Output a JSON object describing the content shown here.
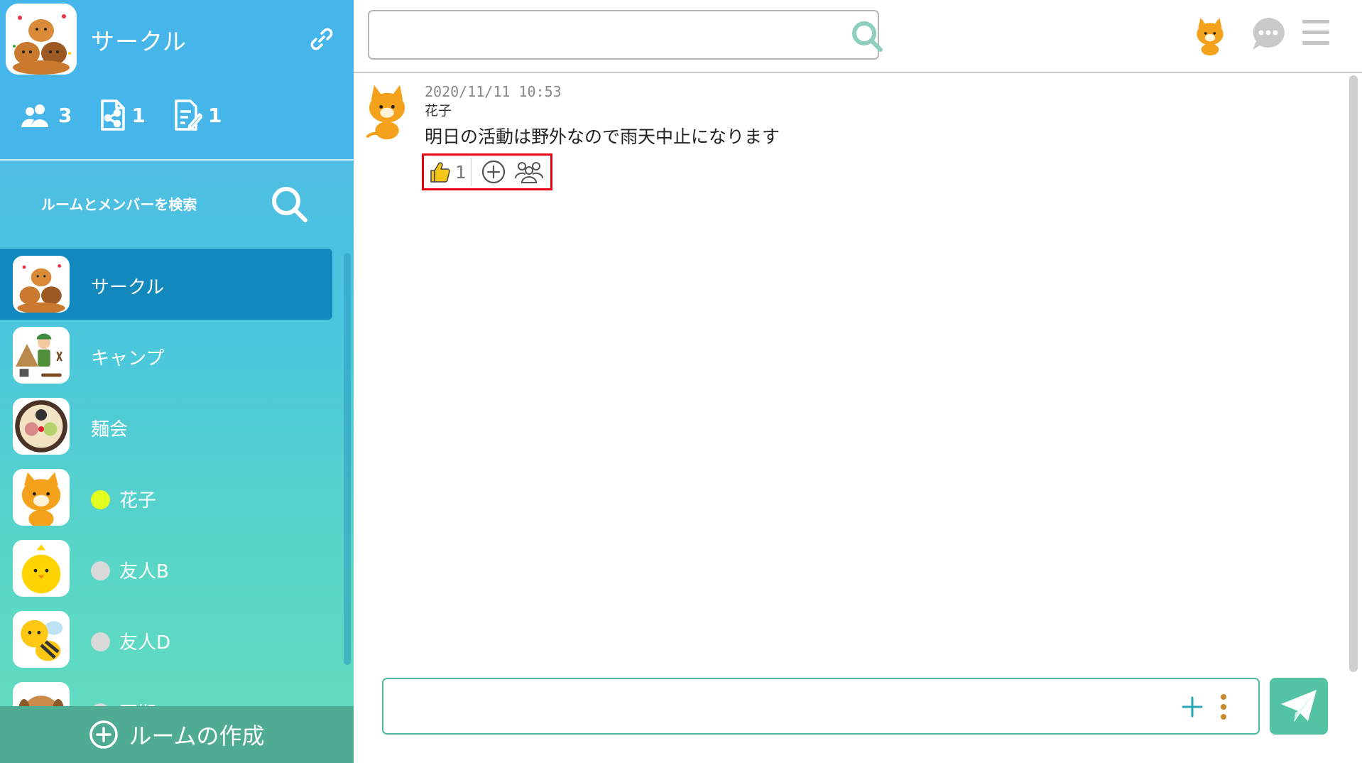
{
  "colors": {
    "sidebar_head": "#46b5ea",
    "active_room": "#1288bd",
    "create_room_bar": "#4fab94",
    "send_button": "#54c2a4",
    "highlight_border": "#e60012",
    "status_online": "#e2ff1e",
    "status_offline": "#d9d9d9"
  },
  "sidebar": {
    "title": "サークル",
    "stats": {
      "members": "3",
      "shared_files": "1",
      "notes": "1"
    },
    "search_label": "ルームとメンバーを検索",
    "rooms": [
      {
        "name": "サークル",
        "avatar": "dogs-group-icon",
        "active": true
      },
      {
        "name": "キャンプ",
        "avatar": "camp-icon",
        "active": false
      },
      {
        "name": "麺会",
        "avatar": "ramen-icon",
        "active": false
      },
      {
        "name": "花子",
        "avatar": "cat-icon",
        "status": "online"
      },
      {
        "name": "友人B",
        "avatar": "chick-icon",
        "status": "offline"
      },
      {
        "name": "友人D",
        "avatar": "bee-icon",
        "status": "offline"
      },
      {
        "name": "同期",
        "avatar": "dog-icon",
        "status": "offline"
      }
    ],
    "create_room_label": "ルームの作成"
  },
  "topbar": {
    "search_value": "",
    "search_placeholder": ""
  },
  "messages": [
    {
      "time": "2020/11/11 10:53",
      "author": "花子",
      "text": "明日の活動は野外なので雨天中止になります",
      "reactions": [
        {
          "icon": "thumbs-up-icon",
          "count": "1"
        }
      ]
    }
  ],
  "composer": {
    "value": "",
    "placeholder": ""
  }
}
